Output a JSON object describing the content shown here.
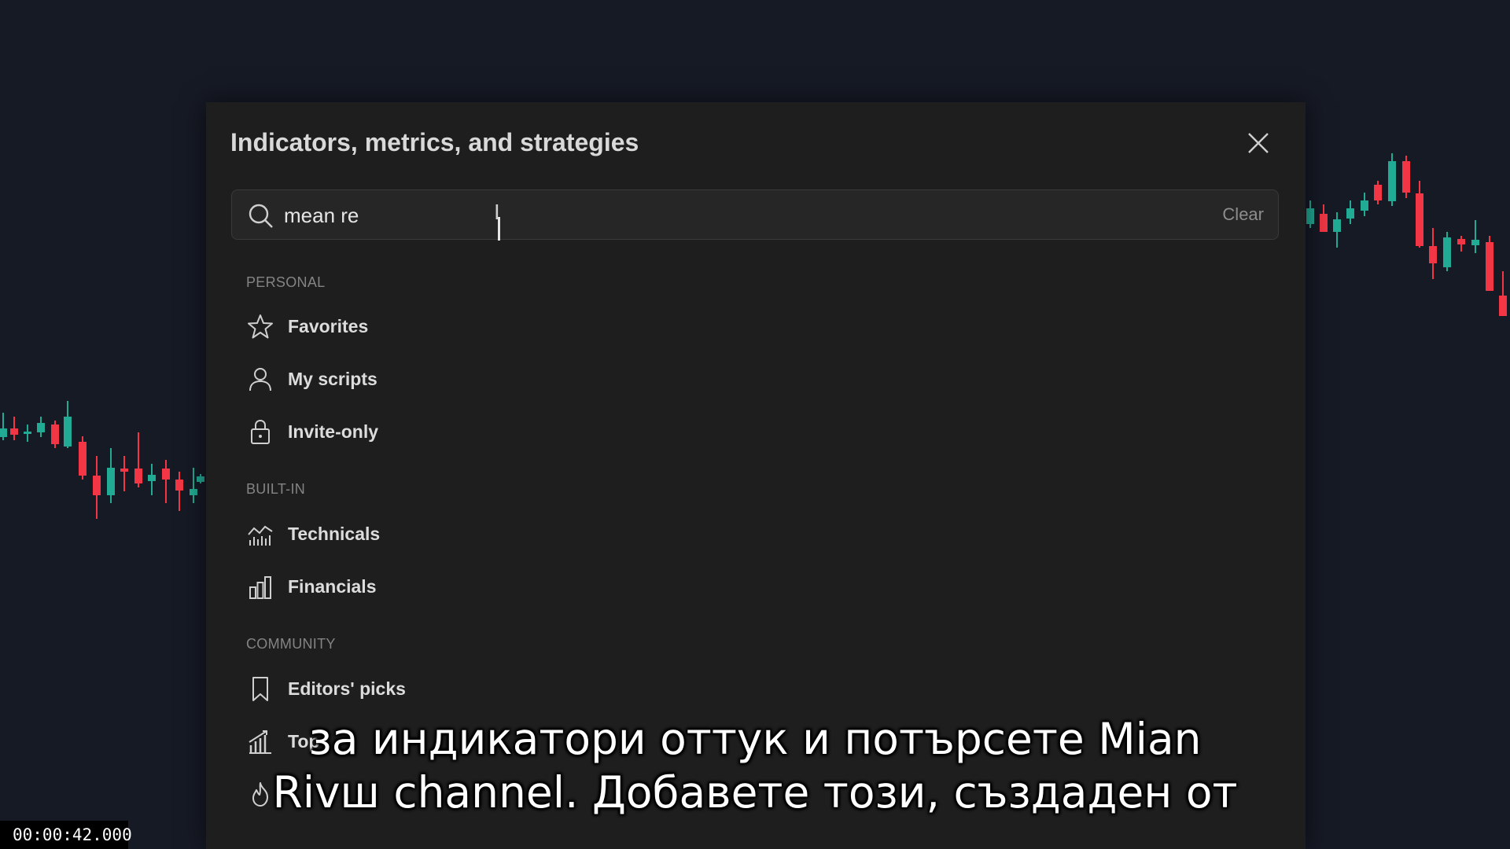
{
  "dialog": {
    "title": "Indicators, metrics, and strategies",
    "close_icon": "close-icon",
    "search": {
      "value": "mean re",
      "placeholder": "",
      "clear_label": "Clear",
      "icon": "search-icon"
    }
  },
  "sections": [
    {
      "header": "PERSONAL",
      "items": [
        {
          "label": "Favorites",
          "icon": "star-icon"
        },
        {
          "label": "My scripts",
          "icon": "user-icon"
        },
        {
          "label": "Invite-only",
          "icon": "lock-icon"
        }
      ]
    },
    {
      "header": "BUILT-IN",
      "items": [
        {
          "label": "Technicals",
          "icon": "technicals-icon"
        },
        {
          "label": "Financials",
          "icon": "financials-icon"
        }
      ]
    },
    {
      "header": "COMMUNITY",
      "items": [
        {
          "label": "Editors' picks",
          "icon": "bookmark-icon"
        },
        {
          "label": "Top",
          "icon": "top-chart-icon"
        },
        {
          "label": "",
          "icon": "trending-flame-icon"
        }
      ]
    }
  ],
  "subtitles": {
    "line1": "за индикатори оттук и потърсете Mian",
    "line2": "Rivш channel. Добавете този, създаден от"
  },
  "video_timestamp": "00:00:42.000",
  "colors": {
    "background": "#161a25",
    "dialog_bg": "#1e1e1e",
    "candle_up": "#22ab94",
    "candle_down": "#f23645"
  }
}
